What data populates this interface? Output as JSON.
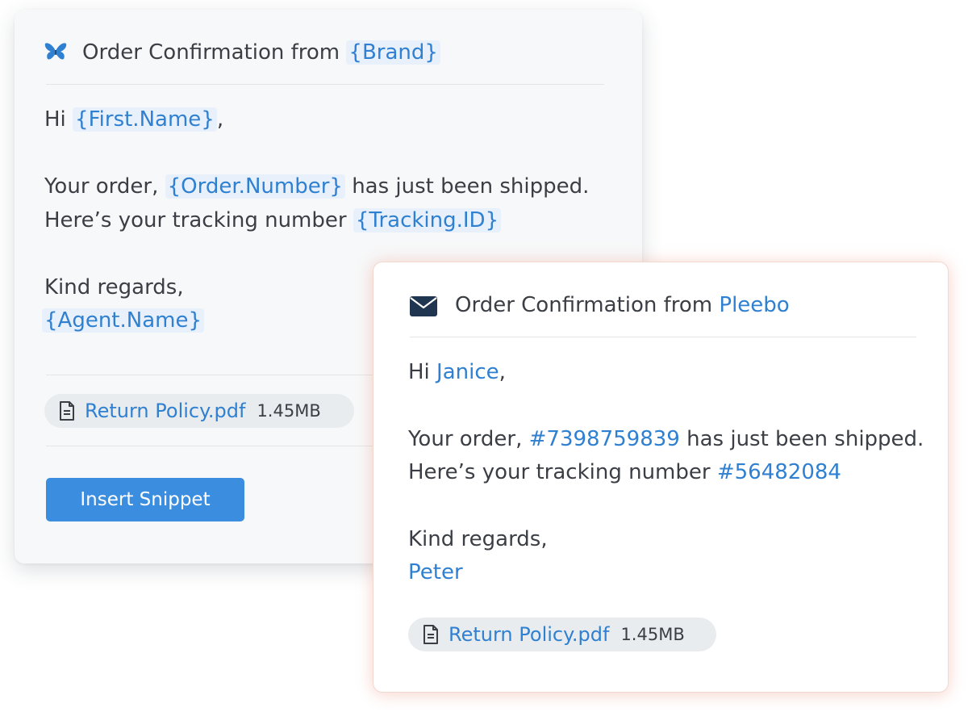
{
  "template_card": {
    "title_prefix": "Order Confirmation from",
    "brand_var": "{Brand}",
    "greeting_prefix": "Hi",
    "first_name_var": "{First.Name}",
    "greeting_suffix": ",",
    "order_prefix": "Your order,",
    "order_var": "{Order.Number}",
    "order_suffix": "has just been shipped.",
    "tracking_prefix": "Here’s your tracking number",
    "tracking_var": "{Tracking.ID}",
    "regards": "Kind regards,",
    "agent_var": "{Agent.Name}",
    "attachment": {
      "icon": "file-icon",
      "name": "Return Policy.pdf",
      "size": "1.45MB"
    },
    "insert_button_label": "Insert Snippet",
    "logo_icon": "butterfly-icon",
    "colors": {
      "variable_text": "#2f80d1",
      "variable_bg": "#e8f1fb",
      "button_bg": "#3b8de0",
      "card_bg": "#f7f8f9"
    }
  },
  "preview_card": {
    "title_prefix": "Order Confirmation from",
    "brand_value": "Pleebo",
    "greeting_prefix": "Hi",
    "first_name_value": "Janice",
    "greeting_suffix": ",",
    "order_prefix": "Your order,",
    "order_value": "#7398759839",
    "order_suffix": "has just been shipped.",
    "tracking_prefix": "Here’s your tracking number",
    "tracking_value": "#56482084",
    "regards": "Kind regards,",
    "agent_value": "Peter",
    "attachment": {
      "icon": "file-icon",
      "name": "Return Policy.pdf",
      "size": "1.45MB"
    },
    "mail_icon": "envelope-icon",
    "colors": {
      "value_text": "#2f80d1",
      "border_glow": "#f3d8d0"
    }
  }
}
